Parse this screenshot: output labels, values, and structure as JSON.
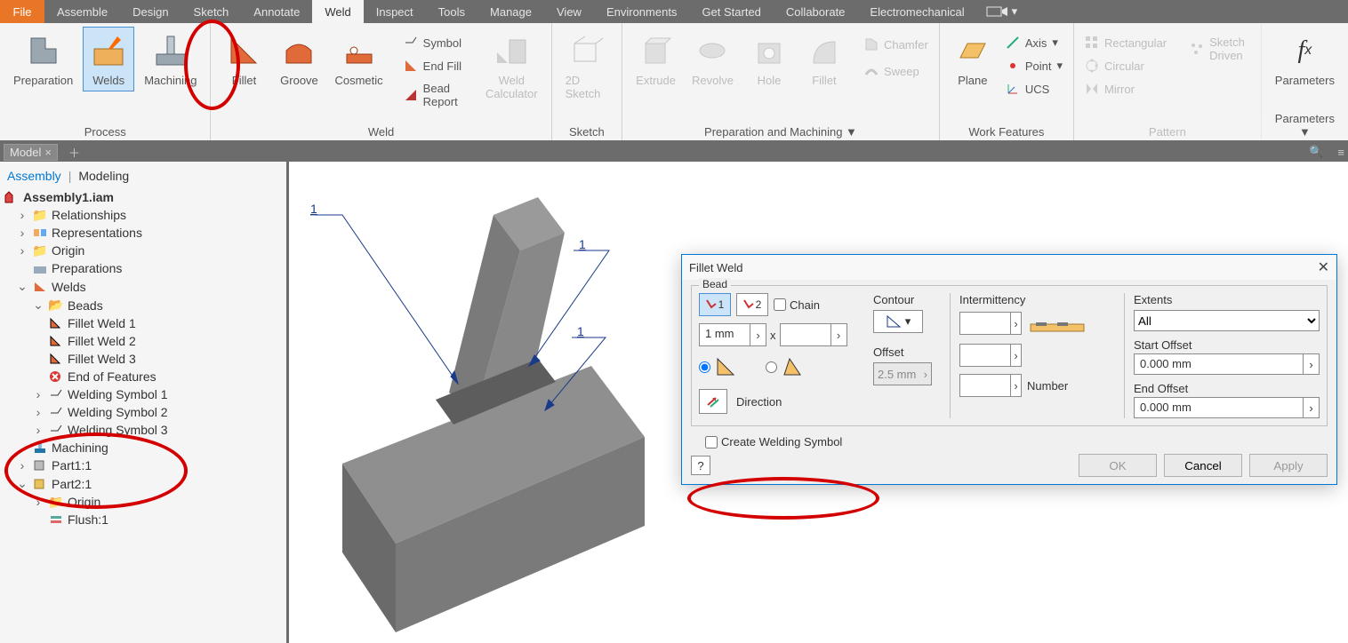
{
  "menu": {
    "file": "File",
    "tabs": [
      "Assemble",
      "Design",
      "Sketch",
      "Annotate",
      "Weld",
      "Inspect",
      "Tools",
      "Manage",
      "View",
      "Environments",
      "Get Started",
      "Collaborate",
      "Electromechanical"
    ],
    "active": "Weld"
  },
  "ribbon": {
    "process": {
      "label": "Process",
      "preparation": "Preparation",
      "welds": "Welds",
      "machining": "Machining"
    },
    "weld_group": {
      "label": "Weld",
      "fillet": "Fillet",
      "groove": "Groove",
      "cosmetic": "Cosmetic",
      "symbol": "Symbol",
      "end_fill": "End Fill",
      "bead_report": "Bead Report",
      "calculator": "Weld Calculator"
    },
    "sketch": {
      "label": "Sketch",
      "sketch2d": "2D Sketch"
    },
    "prep_mach": {
      "label": "Preparation and Machining",
      "extrude": "Extrude",
      "revolve": "Revolve",
      "hole": "Hole",
      "fillet_f": "Fillet",
      "chamfer": "Chamfer",
      "sweep": "Sweep"
    },
    "work_features": {
      "label": "Work Features",
      "plane": "Plane",
      "axis": "Axis",
      "point": "Point",
      "ucs": "UCS"
    },
    "pattern": {
      "label": "Pattern",
      "rectangular": "Rectangular",
      "circular": "Circular",
      "mirror": "Mirror",
      "sketch_driven": "Sketch Driven"
    },
    "parameters": {
      "label": "Parameters",
      "btn": "Parameters"
    }
  },
  "panel": {
    "model": "Model"
  },
  "tree": {
    "tab_assembly": "Assembly",
    "tab_modeling": "Modeling",
    "root": "Assembly1.iam",
    "relationships": "Relationships",
    "representations": "Representations",
    "origin": "Origin",
    "preparations": "Preparations",
    "welds": "Welds",
    "beads": "Beads",
    "fillet1": "Fillet Weld 1",
    "fillet2": "Fillet Weld 2",
    "fillet3": "Fillet Weld 3",
    "eof": "End of Features",
    "ws1": "Welding Symbol 1",
    "ws2": "Welding Symbol 2",
    "ws3": "Welding Symbol 3",
    "machining": "Machining",
    "part1": "Part1:1",
    "part2": "Part2:1",
    "origin2": "Origin",
    "flush": "Flush:1"
  },
  "callouts": {
    "a": "1",
    "b": "1",
    "c": "1"
  },
  "dialog": {
    "title": "Fillet Weld",
    "bead": "Bead",
    "sel1": "1",
    "sel2": "2",
    "chain": "Chain",
    "size1": "1 mm",
    "x": "x",
    "size2": "",
    "direction": "Direction",
    "contour": "Contour",
    "offset": "Offset",
    "offset_val": "2.5 mm",
    "intermittency": "Intermittency",
    "number": "Number",
    "extents": "Extents",
    "extents_val": "All",
    "start_offset": "Start Offset",
    "start_val": "0.000 mm",
    "end_offset": "End Offset",
    "end_val": "0.000 mm",
    "create_symbol": "Create Welding Symbol",
    "ok": "OK",
    "cancel": "Cancel",
    "apply": "Apply"
  }
}
